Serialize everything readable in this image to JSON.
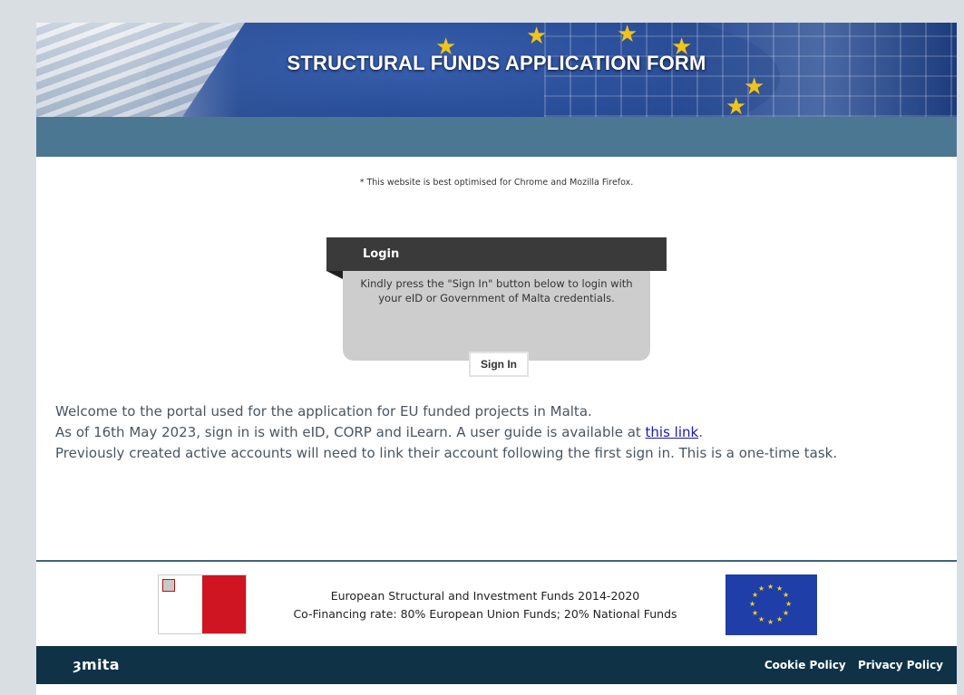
{
  "banner": {
    "title": "STRUCTURAL FUNDS APPLICATION FORM"
  },
  "notice": "* This website is best optimised for Chrome and Mozilla Firefox.",
  "login": {
    "title": "Login",
    "message": "Kindly press the \"Sign In\" button below to login with your eID or Government of Malta credentials.",
    "signin_label": "Sign In"
  },
  "welcome": {
    "line1": "Welcome to the portal used for the application for EU funded projects in Malta.",
    "line2_prefix": "As of 16th May 2023, sign in is with  eID, CORP and iLearn. A user guide is available at ",
    "line2_link": "this link",
    "line2_suffix": ".",
    "line3": "Previously created active accounts will need to link their account following the first sign in. This is a one-time task."
  },
  "funds": {
    "line1": "European Structural and Investment Funds 2014-2020",
    "line2": "Co-Financing rate: 80% European Union Funds; 20% National Funds"
  },
  "footer": {
    "logo": "mita",
    "links": [
      "Cookie Policy",
      "Privacy Policy"
    ]
  },
  "colors": {
    "navbar": "#4c7793",
    "footer": "#0f3247",
    "login_header": "#3a3a3a",
    "login_body": "#cdcdcd",
    "link": "#1a1aa6"
  }
}
